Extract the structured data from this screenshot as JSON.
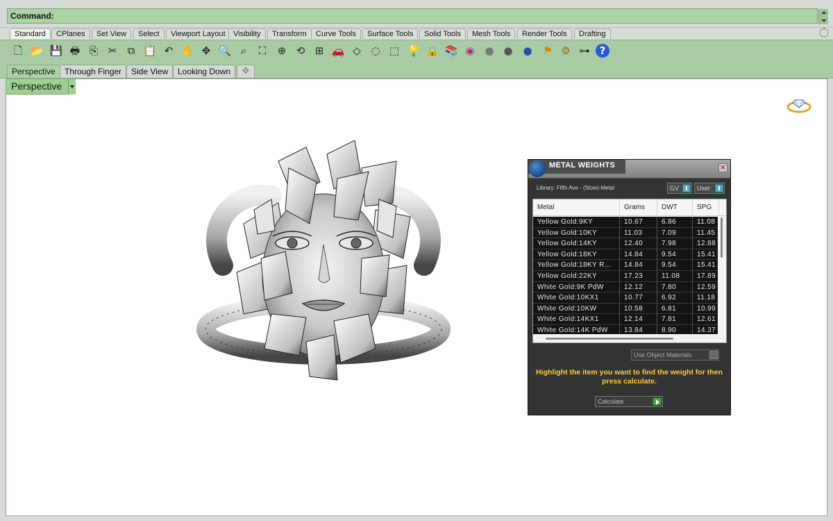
{
  "command": {
    "label": "Command:"
  },
  "toolbar_tabs": [
    {
      "label": "Standard",
      "active": true
    },
    {
      "label": "CPlanes"
    },
    {
      "label": "Set View"
    },
    {
      "label": "Select"
    },
    {
      "label": "Viewport Layout"
    },
    {
      "label": "Visibility"
    },
    {
      "label": "Transform"
    },
    {
      "label": "Curve Tools"
    },
    {
      "label": "Surface Tools"
    },
    {
      "label": "Solid Tools"
    },
    {
      "label": "Mesh Tools"
    },
    {
      "label": "Render Tools"
    },
    {
      "label": "Drafting"
    }
  ],
  "tools": [
    {
      "icon": "new-icon",
      "glyph": "🗋"
    },
    {
      "icon": "open-icon",
      "glyph": "📂"
    },
    {
      "icon": "save-icon",
      "glyph": "💾"
    },
    {
      "icon": "print-icon",
      "glyph": "🖶"
    },
    {
      "icon": "copy-to-clipboard-icon",
      "glyph": "⎘"
    },
    {
      "icon": "cut-icon",
      "glyph": "✂"
    },
    {
      "icon": "copy-icon",
      "glyph": "⧉"
    },
    {
      "icon": "paste-icon",
      "glyph": "📋"
    },
    {
      "icon": "undo-icon",
      "glyph": "↶"
    },
    {
      "icon": "pan-icon",
      "glyph": "✋"
    },
    {
      "icon": "move-view-icon",
      "glyph": "✥"
    },
    {
      "icon": "zoom-icon",
      "glyph": "🔍"
    },
    {
      "icon": "zoom-window-icon",
      "glyph": "⌕"
    },
    {
      "icon": "zoom-extents-icon",
      "glyph": "⛶"
    },
    {
      "icon": "zoom-selected-icon",
      "glyph": "⊕"
    },
    {
      "icon": "rotate-view-icon",
      "glyph": "⟲"
    },
    {
      "icon": "four-viewports-icon",
      "glyph": "⊞"
    },
    {
      "icon": "car-icon",
      "glyph": "🚗"
    },
    {
      "icon": "hide-icon",
      "glyph": "◇"
    },
    {
      "icon": "show-icon",
      "glyph": "◌"
    },
    {
      "icon": "select-icon",
      "glyph": "⬚"
    },
    {
      "icon": "light-icon",
      "glyph": "💡"
    },
    {
      "icon": "lock-icon",
      "glyph": "🔒"
    },
    {
      "icon": "layers-icon",
      "glyph": "📚"
    },
    {
      "icon": "color-wheel-icon",
      "glyph": "◉"
    },
    {
      "icon": "render-sphere-icon",
      "glyph": "●"
    },
    {
      "icon": "rendered-sphere-icon",
      "glyph": "●"
    },
    {
      "icon": "blue-sphere-icon",
      "glyph": "●"
    },
    {
      "icon": "flag-icon",
      "glyph": "⚑"
    },
    {
      "icon": "settings-icon",
      "glyph": "⚙"
    },
    {
      "icon": "network-icon",
      "glyph": "⊶"
    },
    {
      "icon": "help-icon",
      "glyph": "?"
    }
  ],
  "viewport_tabs": [
    {
      "label": "Perspective",
      "active": true
    },
    {
      "label": "Through Finger"
    },
    {
      "label": "Side View"
    },
    {
      "label": "Looking Down"
    }
  ],
  "viewport": {
    "title": "Perspective"
  },
  "panel": {
    "title": "METAL WEIGHTS",
    "library": "Library: Fifth Ave - (Slow)-Metal",
    "select1": "GV",
    "select2": "User",
    "columns": [
      "Metal",
      "Grams",
      "DWT",
      "SPG"
    ],
    "rows": [
      [
        "Yellow Gold:9KY",
        "10.67",
        "6.86",
        "11.08"
      ],
      [
        "Yellow Gold:10KY",
        "11.03",
        "7.09",
        "11.45"
      ],
      [
        "Yellow Gold:14KY",
        "12.40",
        "7.98",
        "12.88"
      ],
      [
        "Yellow Gold:18KY",
        "14.84",
        "9.54",
        "15.41"
      ],
      [
        "Yellow Gold:18KY R...",
        "14.84",
        "9.54",
        "15.41"
      ],
      [
        "Yellow Gold:22KY",
        "17.23",
        "11.08",
        "17.89"
      ],
      [
        "White Gold:9K PdW",
        "12.12",
        "7.80",
        "12.59"
      ],
      [
        "White Gold:10KX1",
        "10.77",
        "6.92",
        "11.18"
      ],
      [
        "White Gold:10KW",
        "10.58",
        "6.81",
        "10.99"
      ],
      [
        "White Gold:14KX1",
        "12.14",
        "7.81",
        "12.61"
      ],
      [
        "White Gold:14K PdW",
        "13.84",
        "8.90",
        "14.37"
      ]
    ],
    "use_materials": "Use Object Materials",
    "hint": "Highlight the item you want to find the weight for then press calculate.",
    "calculate": "Calculate"
  }
}
